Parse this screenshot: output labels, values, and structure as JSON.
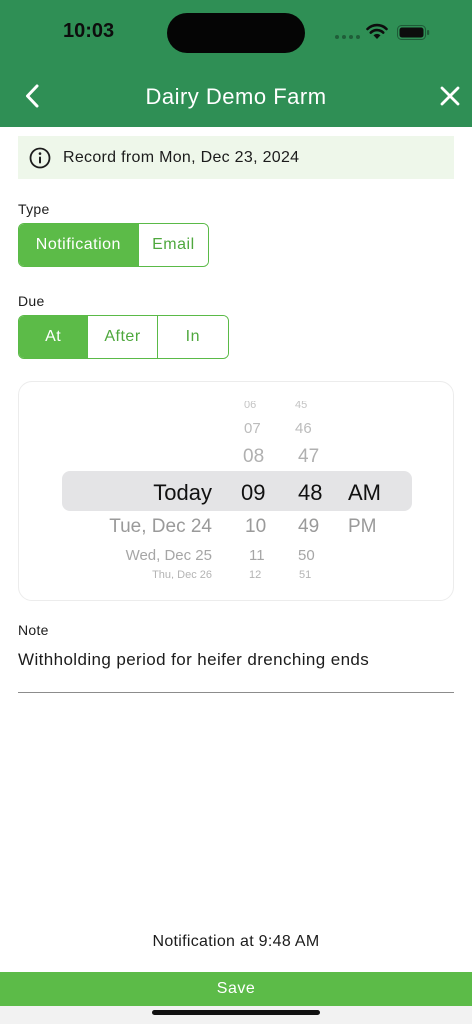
{
  "status_bar": {
    "time": "10:03"
  },
  "header": {
    "title": "Dairy Demo Farm",
    "back_icon": "chevron-left-icon",
    "close_icon": "close-icon"
  },
  "record_banner": {
    "icon": "info-icon",
    "text": "Record from Mon, Dec 23, 2024"
  },
  "type_field": {
    "label": "Type",
    "options": [
      "Notification",
      "Email"
    ],
    "selected": "Notification"
  },
  "due_field": {
    "label": "Due",
    "options": [
      "At",
      "After",
      "In"
    ],
    "selected": "At"
  },
  "picker": {
    "date_column": [
      "Today",
      "Tue, Dec 24",
      "Wed, Dec 25",
      "Thu, Dec 26"
    ],
    "hour_column": [
      "06",
      "07",
      "08",
      "09",
      "10",
      "11",
      "12"
    ],
    "minute_column": [
      "45",
      "46",
      "47",
      "48",
      "49",
      "50",
      "51"
    ],
    "ampm_column": [
      "AM",
      "PM"
    ],
    "selected": {
      "date": "Today",
      "hour": "09",
      "minute": "48",
      "ampm": "AM"
    }
  },
  "note": {
    "label": "Note",
    "value": "Withholding period for heifer drenching ends"
  },
  "summary": "Notification at 9:48 AM",
  "save_label": "Save",
  "colors": {
    "header": "#2f8f55",
    "accent": "#5cbb48",
    "banner_bg": "#eef7ea"
  }
}
